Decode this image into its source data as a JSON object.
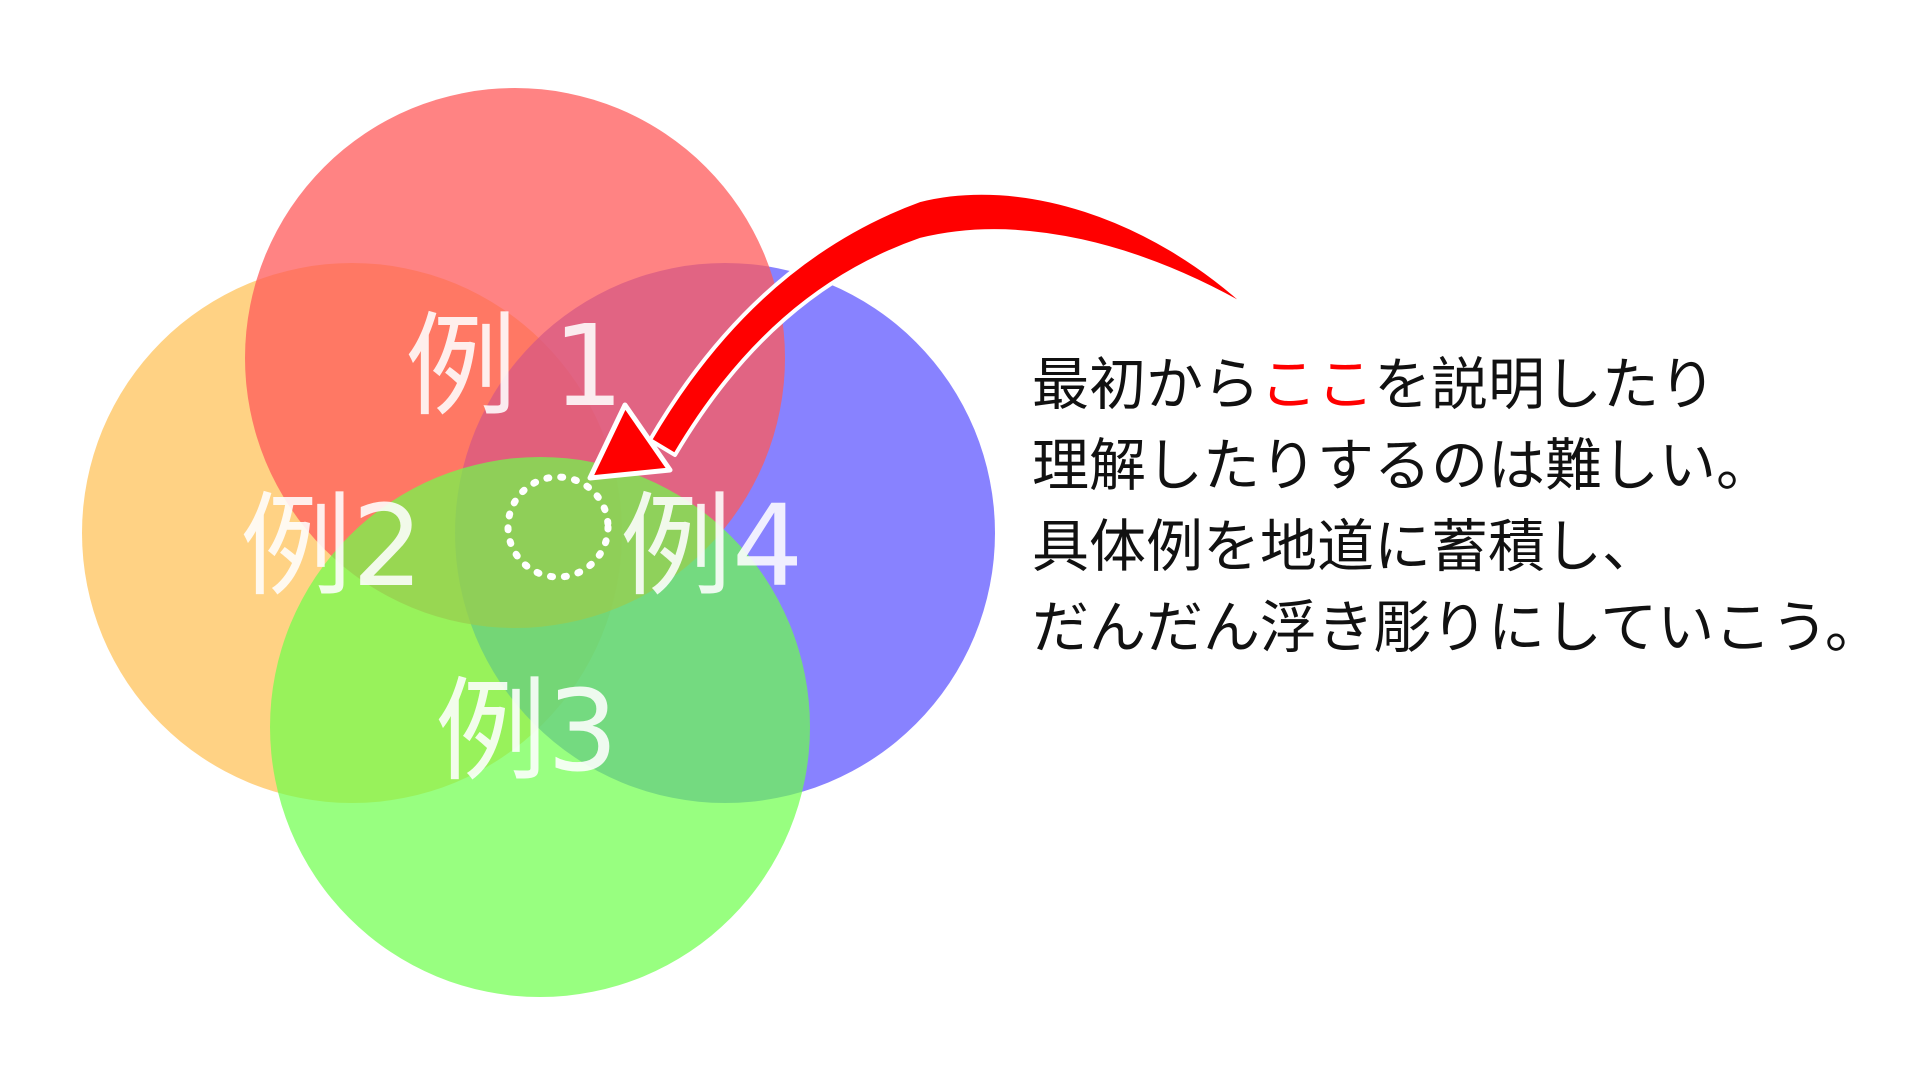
{
  "circles": [
    {
      "id": "example-1",
      "label": "例 1",
      "color": "#ff5a5a",
      "opacity": 0.75
    },
    {
      "id": "example-2",
      "label": "例2",
      "color": "#ffbf50",
      "opacity": 0.7
    },
    {
      "id": "example-3",
      "label": "例3",
      "color": "#6cff4a",
      "opacity": 0.7
    },
    {
      "id": "example-4",
      "label": "例4",
      "color": "#5a52ff",
      "opacity": 0.72
    }
  ],
  "center_marker": {
    "icon": "dotted-circle-icon",
    "color": "#ffffff"
  },
  "arrow": {
    "icon": "curved-arrow-icon",
    "color": "#ff0000",
    "outline": "#ffffff"
  },
  "caption": {
    "line1_before": "最初から",
    "line1_highlight": "ここ",
    "line1_after": "を説明したり",
    "line2": "理解したりするのは難しい。",
    "line3": "具体例を地道に蓄積し、",
    "line4": "だんだん浮き彫りにしていこう。",
    "highlight_color": "#ff0000"
  }
}
